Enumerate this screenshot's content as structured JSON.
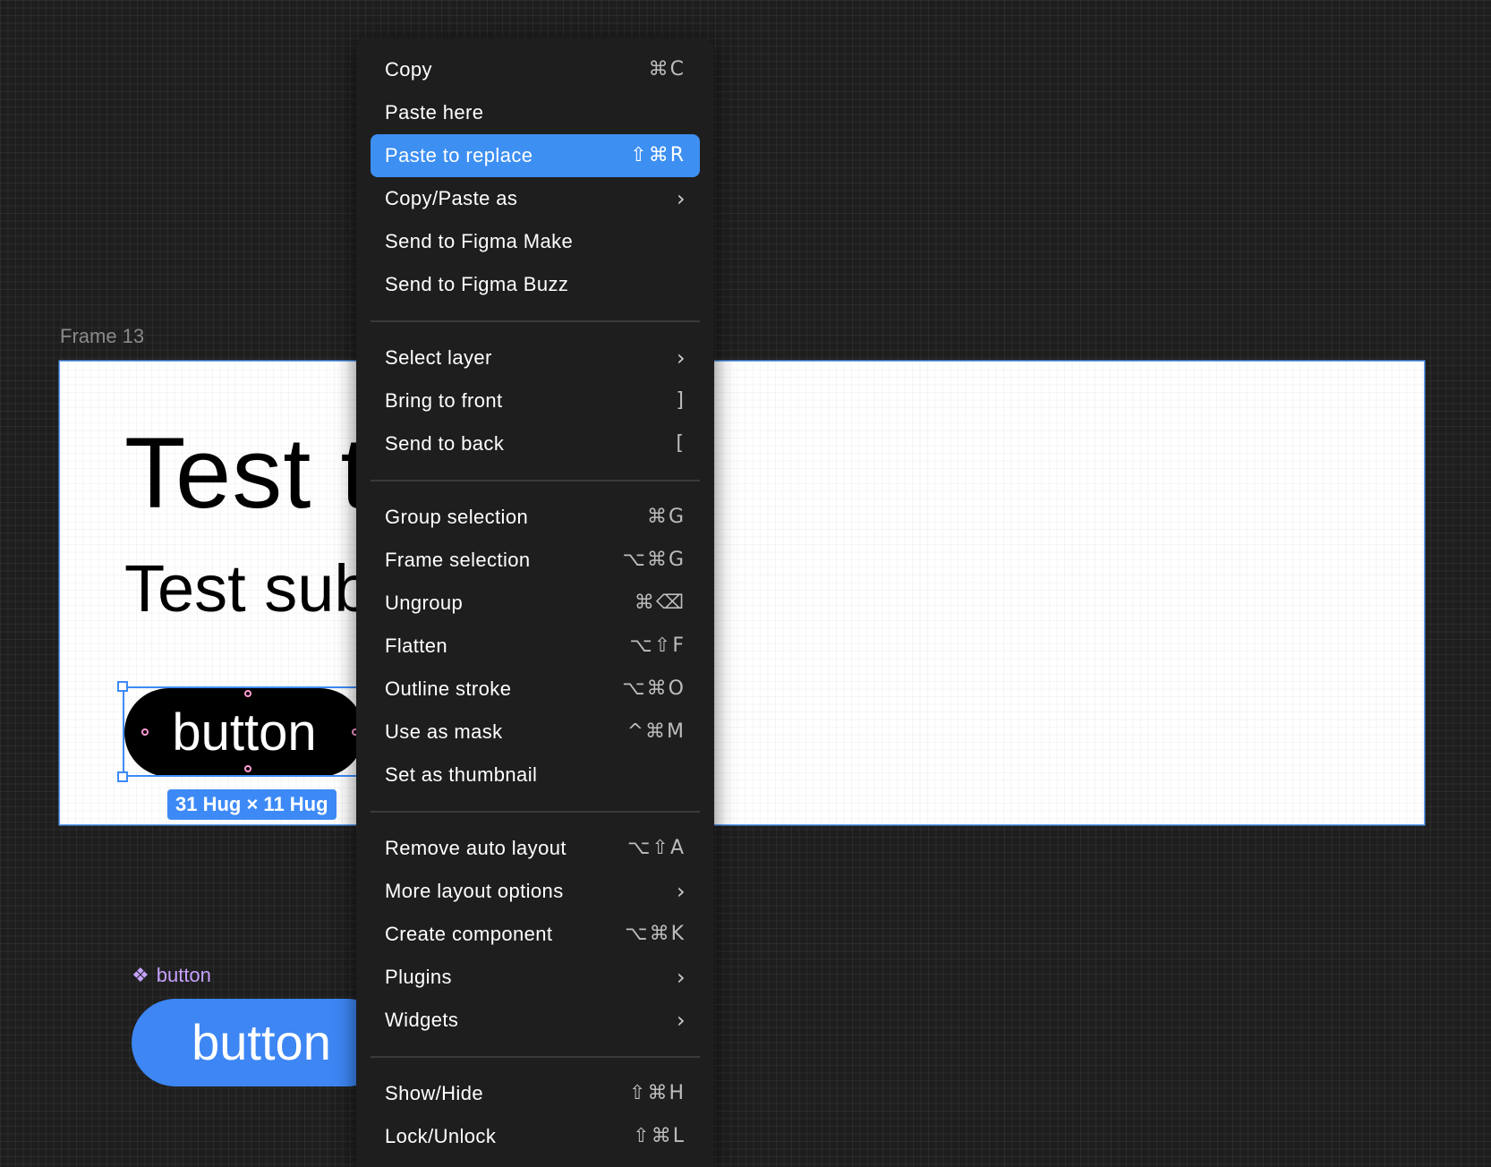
{
  "canvas": {
    "frame_label": "Frame 13",
    "frame_title": "Test t",
    "frame_subtitle": "Test sub",
    "instance_button_label": "button",
    "size_badge": "31 Hug × 11 Hug",
    "component_name": "button",
    "component_icon": "component-icon",
    "component_button_label": "button"
  },
  "colors": {
    "canvas_bg": "#1e1e1e",
    "menu_bg": "#1e1e1e",
    "highlight": "#3d8ff2",
    "selection": "#3d8af7",
    "component_purple": "#c6a2ff",
    "component_button": "#3d86f4"
  },
  "menu": {
    "groups": [
      [
        {
          "label": "Copy",
          "shortcut": "⌘C"
        },
        {
          "label": "Paste here",
          "shortcut": ""
        },
        {
          "label": "Paste to replace",
          "shortcut": "⇧⌘R",
          "highlighted": true
        },
        {
          "label": "Copy/Paste as",
          "submenu": true
        },
        {
          "label": "Send to Figma Make",
          "shortcut": ""
        },
        {
          "label": "Send to Figma Buzz",
          "shortcut": ""
        }
      ],
      [
        {
          "label": "Select layer",
          "submenu": true
        },
        {
          "label": "Bring to front",
          "shortcut": "]"
        },
        {
          "label": "Send to back",
          "shortcut": "["
        }
      ],
      [
        {
          "label": "Group selection",
          "shortcut": "⌘G"
        },
        {
          "label": "Frame selection",
          "shortcut": "⌥⌘G"
        },
        {
          "label": "Ungroup",
          "shortcut": "⌘⌫"
        },
        {
          "label": "Flatten",
          "shortcut": "⌥⇧F"
        },
        {
          "label": "Outline stroke",
          "shortcut": "⌥⌘O"
        },
        {
          "label": "Use as mask",
          "shortcut": "^⌘M"
        },
        {
          "label": "Set as thumbnail",
          "shortcut": ""
        }
      ],
      [
        {
          "label": "Remove auto layout",
          "shortcut": "⌥⇧A"
        },
        {
          "label": "More layout options",
          "submenu": true
        },
        {
          "label": "Create component",
          "shortcut": "⌥⌘K"
        },
        {
          "label": "Plugins",
          "submenu": true
        },
        {
          "label": "Widgets",
          "submenu": true
        }
      ],
      [
        {
          "label": "Show/Hide",
          "shortcut": "⇧⌘H"
        },
        {
          "label": "Lock/Unlock",
          "shortcut": "⇧⌘L"
        }
      ]
    ]
  }
}
